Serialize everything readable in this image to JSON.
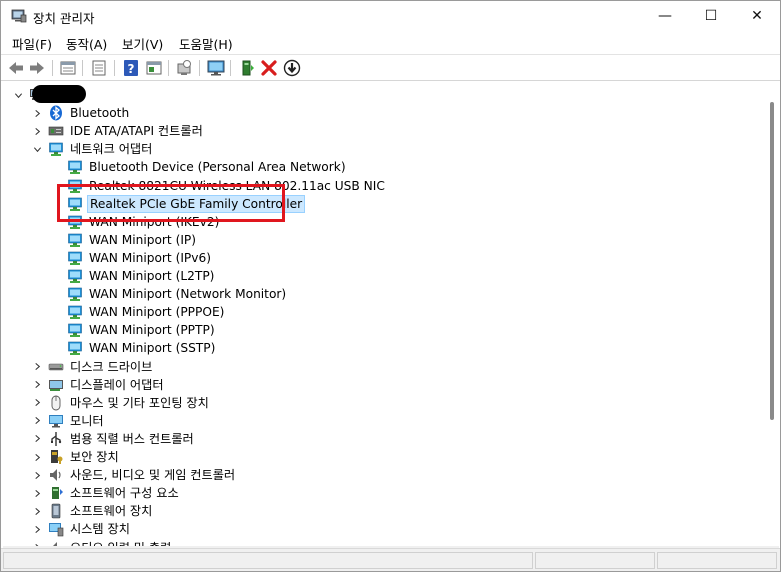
{
  "window": {
    "title": "장치 관리자",
    "controls": {
      "minimize": "—",
      "maximize": "☐",
      "close": "✕"
    }
  },
  "menu": [
    "파일(F)",
    "동작(A)",
    "보기(V)",
    "도움말(H)"
  ],
  "toolbar": [
    "back-icon",
    "forward-icon",
    "properties-icon",
    "view-icon",
    "help-icon",
    "show-hidden-icon",
    "scan-hardware-icon",
    "monitor-icon",
    "update-driver-icon",
    "uninstall-icon",
    "disable-icon"
  ],
  "tree": {
    "root": "",
    "categories": [
      {
        "label": "Bluetooth",
        "icon": "bluetooth-icon",
        "expanded": false
      },
      {
        "label": "IDE ATA/ATAPI 컨트롤러",
        "icon": "ide-icon",
        "expanded": false
      },
      {
        "label": "네트워크 어댑터",
        "icon": "network-icon",
        "expanded": true,
        "children": [
          "Bluetooth Device (Personal Area Network)",
          "Realtek 8821CU Wireless LAN 802.11ac USB NIC",
          "Realtek PCIe GbE Family Controller",
          "WAN Miniport (IKEv2)",
          "WAN Miniport (IP)",
          "WAN Miniport (IPv6)",
          "WAN Miniport (L2TP)",
          "WAN Miniport (Network Monitor)",
          "WAN Miniport (PPPOE)",
          "WAN Miniport (PPTP)",
          "WAN Miniport (SSTP)"
        ]
      },
      {
        "label": "디스크 드라이브",
        "icon": "disk-icon",
        "expanded": false
      },
      {
        "label": "디스플레이 어댑터",
        "icon": "display-adapter-icon",
        "expanded": false
      },
      {
        "label": "마우스 및 기타 포인팅 장치",
        "icon": "mouse-icon",
        "expanded": false
      },
      {
        "label": "모니터",
        "icon": "monitor-icon",
        "expanded": false
      },
      {
        "label": "범용 직렬 버스 컨트롤러",
        "icon": "usb-icon",
        "expanded": false
      },
      {
        "label": "보안 장치",
        "icon": "security-device-icon",
        "expanded": false
      },
      {
        "label": "사운드, 비디오 및 게임 컨트롤러",
        "icon": "sound-icon",
        "expanded": false
      },
      {
        "label": "소프트웨어 구성 요소",
        "icon": "software-component-icon",
        "expanded": false
      },
      {
        "label": "소프트웨어 장치",
        "icon": "software-device-icon",
        "expanded": false
      },
      {
        "label": "시스템 장치",
        "icon": "system-device-icon",
        "expanded": false
      },
      {
        "label": "오디오 입력 및 출력",
        "icon": "audio-io-icon",
        "expanded": false
      }
    ],
    "selected": "Realtek PCIe GbE Family Controller"
  },
  "colors": {
    "highlight": "#e0161e",
    "selection_bg": "#cce8ff",
    "selection_border": "#99d1ff",
    "net_icon": "#1c8fd6"
  }
}
